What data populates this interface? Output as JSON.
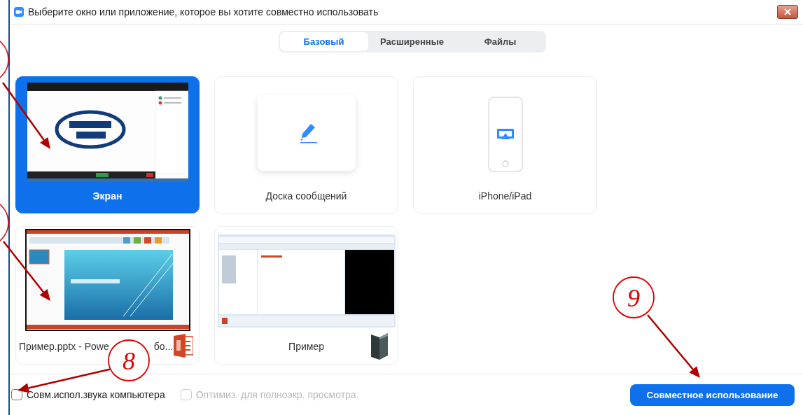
{
  "window": {
    "title": "Выберите окно или приложение, которое вы хотите совместно использовать"
  },
  "tabs": [
    {
      "label": "Базовый",
      "selected": true
    },
    {
      "label": "Расширенные",
      "selected": false
    },
    {
      "label": "Файлы",
      "selected": false
    }
  ],
  "sources": [
    {
      "kind": "screen",
      "label_parts": [
        "Экран"
      ],
      "selected": true
    },
    {
      "kind": "whiteboard",
      "label_parts": [
        "Доска сообщений"
      ],
      "selected": false
    },
    {
      "kind": "iphone",
      "label_parts": [
        "iPhone/iPad"
      ],
      "selected": false
    },
    {
      "kind": "pptx",
      "label_parts": [
        "Пример.pptx - Powe",
        "бо..."
      ],
      "selected": false
    },
    {
      "kind": "folder",
      "label_parts": [
        "Пример"
      ],
      "selected": false
    }
  ],
  "options": [
    {
      "label": "Совм.испол.звука компьютера",
      "checked": false,
      "disabled": false
    },
    {
      "label": "Оптимиз. для полноэкр. просмотра.",
      "checked": false,
      "disabled": true
    }
  ],
  "share_button": "Совместное использование",
  "annotations": [
    {
      "label": "8"
    },
    {
      "label": "9"
    }
  ]
}
